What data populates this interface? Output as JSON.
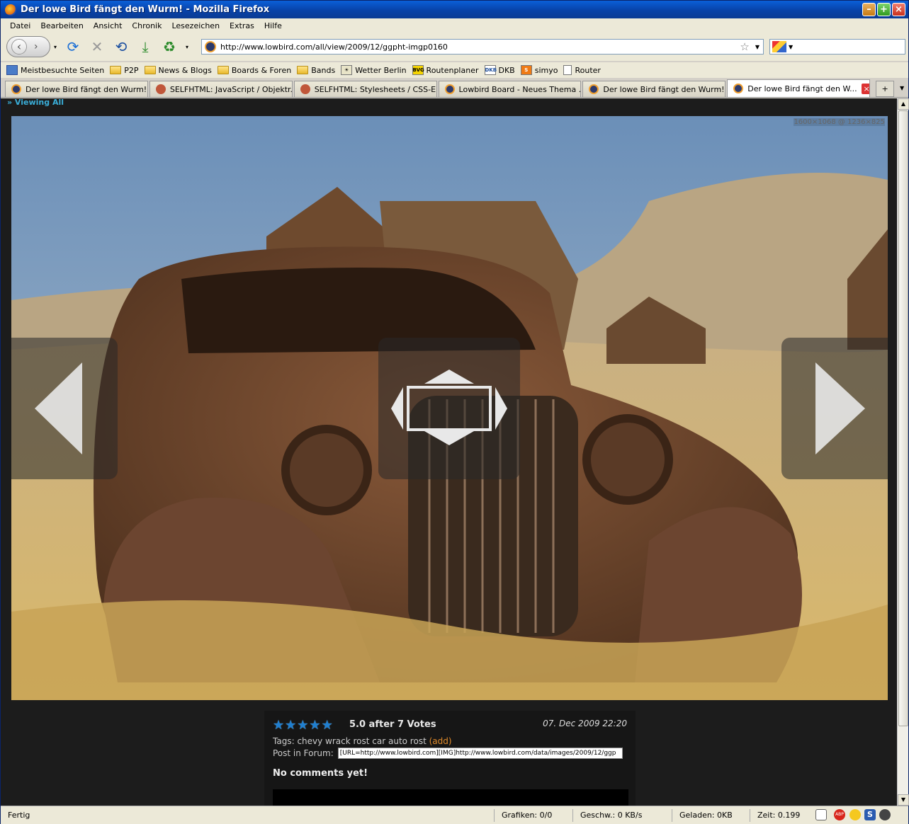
{
  "window": {
    "title": "Der lowe Bird fängt den Wurm! - Mozilla Firefox"
  },
  "menu": [
    "Datei",
    "Bearbeiten",
    "Ansicht",
    "Chronik",
    "Lesezeichen",
    "Extras",
    "Hilfe"
  ],
  "nav": {
    "url": "http://www.lowbird.com/all/view/2009/12/ggpht-imgp0160"
  },
  "bookmarks": [
    "Meistbesuchte Seiten",
    "P2P",
    "News & Blogs",
    "Boards & Foren",
    "Bands",
    "Wetter Berlin",
    "Routenplaner",
    "DKB",
    "simyo",
    "Router"
  ],
  "bookmark_icons": {
    "bvg": "BVG",
    "dkb": "DKB"
  },
  "tabs": [
    "Der lowe Bird fängt den Wurm!",
    "SELFHTML: JavaScript / Objektr...",
    "SELFHTML: Stylesheets / CSS-Ei...",
    "Lowbird Board - Neues Thema ...",
    "Der lowe Bird fängt den Wurm!",
    "Der lowe Bird fängt den W..."
  ],
  "page": {
    "viewing_all": "» Viewing All",
    "resolution": "1600×1068 @ 1236×825",
    "rating": {
      "stars": 5,
      "votes_text": "5.0 after 7 Votes"
    },
    "date": "07. Dec 2009 22:20",
    "tags_label": "Tags:",
    "tags": "chevy wrack rost car auto rost",
    "tags_add": "(add)",
    "forum_label": "Post in Forum:",
    "forum_code": "[URL=http://www.lowbird.com][IMG]http://www.lowbird.com/data/images/2009/12/ggp",
    "no_comments": "No comments yet!"
  },
  "status": {
    "text": "Fertig",
    "grafiken": "Grafiken: 0/0",
    "geschw": "Geschw.: 0 KB/s",
    "geladen": "Geladen: 0KB",
    "zeit": "Zeit: 0.199"
  },
  "colors": {
    "accent": "#3aaed8",
    "star": "#1f7fd0",
    "add_link": "#e08a2a"
  }
}
